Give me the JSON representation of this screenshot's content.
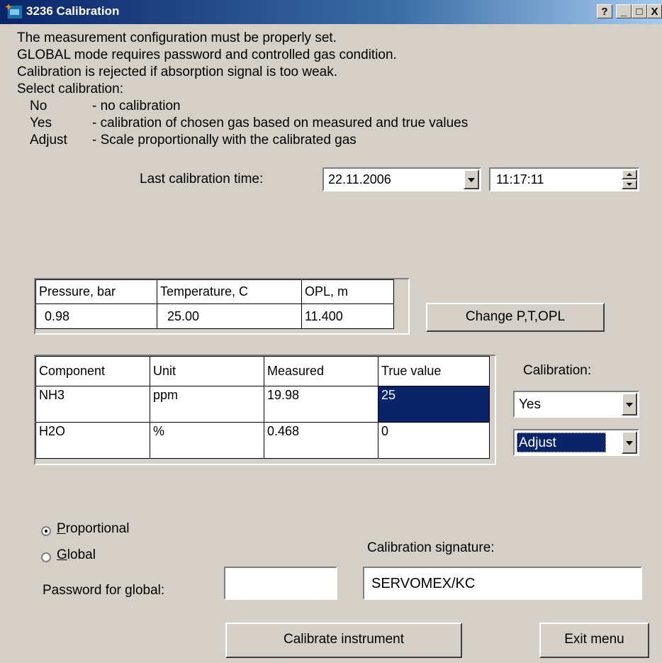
{
  "window": {
    "title": "3236 Calibration",
    "buttons": {
      "help": "?",
      "minimize": "_",
      "maximize": "□",
      "close": "X"
    }
  },
  "info": {
    "lines": [
      "The measurement configuration must be properly set.",
      "GLOBAL mode requires password and controlled gas condition.",
      "Calibration is rejected if absorption signal is too weak.",
      "Select calibration:"
    ],
    "options": [
      {
        "key": "No",
        "desc": "- no calibration"
      },
      {
        "key": "Yes",
        "desc": "- calibration of chosen gas based on measured and true values"
      },
      {
        "key": "Adjust",
        "desc": "- Scale proportionally with the calibrated gas"
      }
    ]
  },
  "last_calibration": {
    "label": "Last calibration time:",
    "date": "22.11.2006",
    "time": "11:17:11"
  },
  "conditions": {
    "headers": [
      "Pressure, bar",
      "Temperature, C",
      "OPL, m"
    ],
    "values": [
      "0.98",
      "25.00",
      "11.400"
    ],
    "change_button": "Change P,T,OPL"
  },
  "components": {
    "headers": [
      "Component",
      "Unit",
      "Measured",
      "True value"
    ],
    "rows": [
      {
        "component": "NH3",
        "unit": "ppm",
        "measured": "19.98",
        "true_value": "25"
      },
      {
        "component": "H2O",
        "unit": "%",
        "measured": "0.468",
        "true_value": "0"
      }
    ],
    "calibration_label": "Calibration:",
    "calibration_values": [
      "Yes",
      "Adjust"
    ]
  },
  "mode": {
    "proportional_first": "P",
    "proportional_rest": "roportional",
    "global_first": "G",
    "global_rest": "lobal",
    "selected": "Proportional",
    "password_label": "Password for global:",
    "password_value": ""
  },
  "signature": {
    "label": "Calibration signature:",
    "value": "SERVOMEX/KC"
  },
  "actions": {
    "calibrate": "Calibrate instrument",
    "exit": "Exit menu"
  },
  "colors": {
    "titlebar": "#0a246a",
    "face": "#d4d0c8",
    "selection": "#0a246a"
  }
}
